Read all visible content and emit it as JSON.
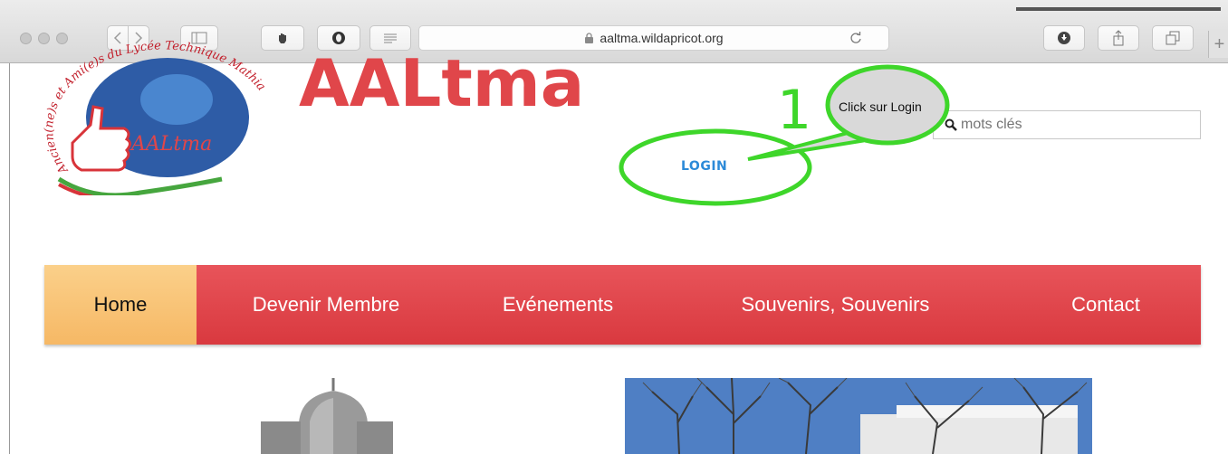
{
  "browser": {
    "url": "aaltma.wildapricot.org",
    "new_tab_label": "+"
  },
  "header": {
    "site_title": "AALtma",
    "login_label": "LOGIN",
    "search_placeholder": "mots clés"
  },
  "logo": {
    "ring_text": "Ancien(ne)s et Ami(e)s du Lycée Technique Mathias Adam",
    "center_text": "AALtma"
  },
  "annotation": {
    "step_number": "1",
    "callout_text": "Click sur Login",
    "color": "#3ed62a"
  },
  "nav": {
    "items": [
      {
        "label": "Home",
        "active": true
      },
      {
        "label": "Devenir Membre",
        "active": false
      },
      {
        "label": "Evénements",
        "active": false
      },
      {
        "label": "Souvenirs, Souvenirs",
        "active": false
      },
      {
        "label": "Contact",
        "active": false
      }
    ]
  },
  "colors": {
    "brand_red": "#e0464a",
    "nav_active": "#f6b865",
    "link_blue": "#2c8ad8"
  }
}
